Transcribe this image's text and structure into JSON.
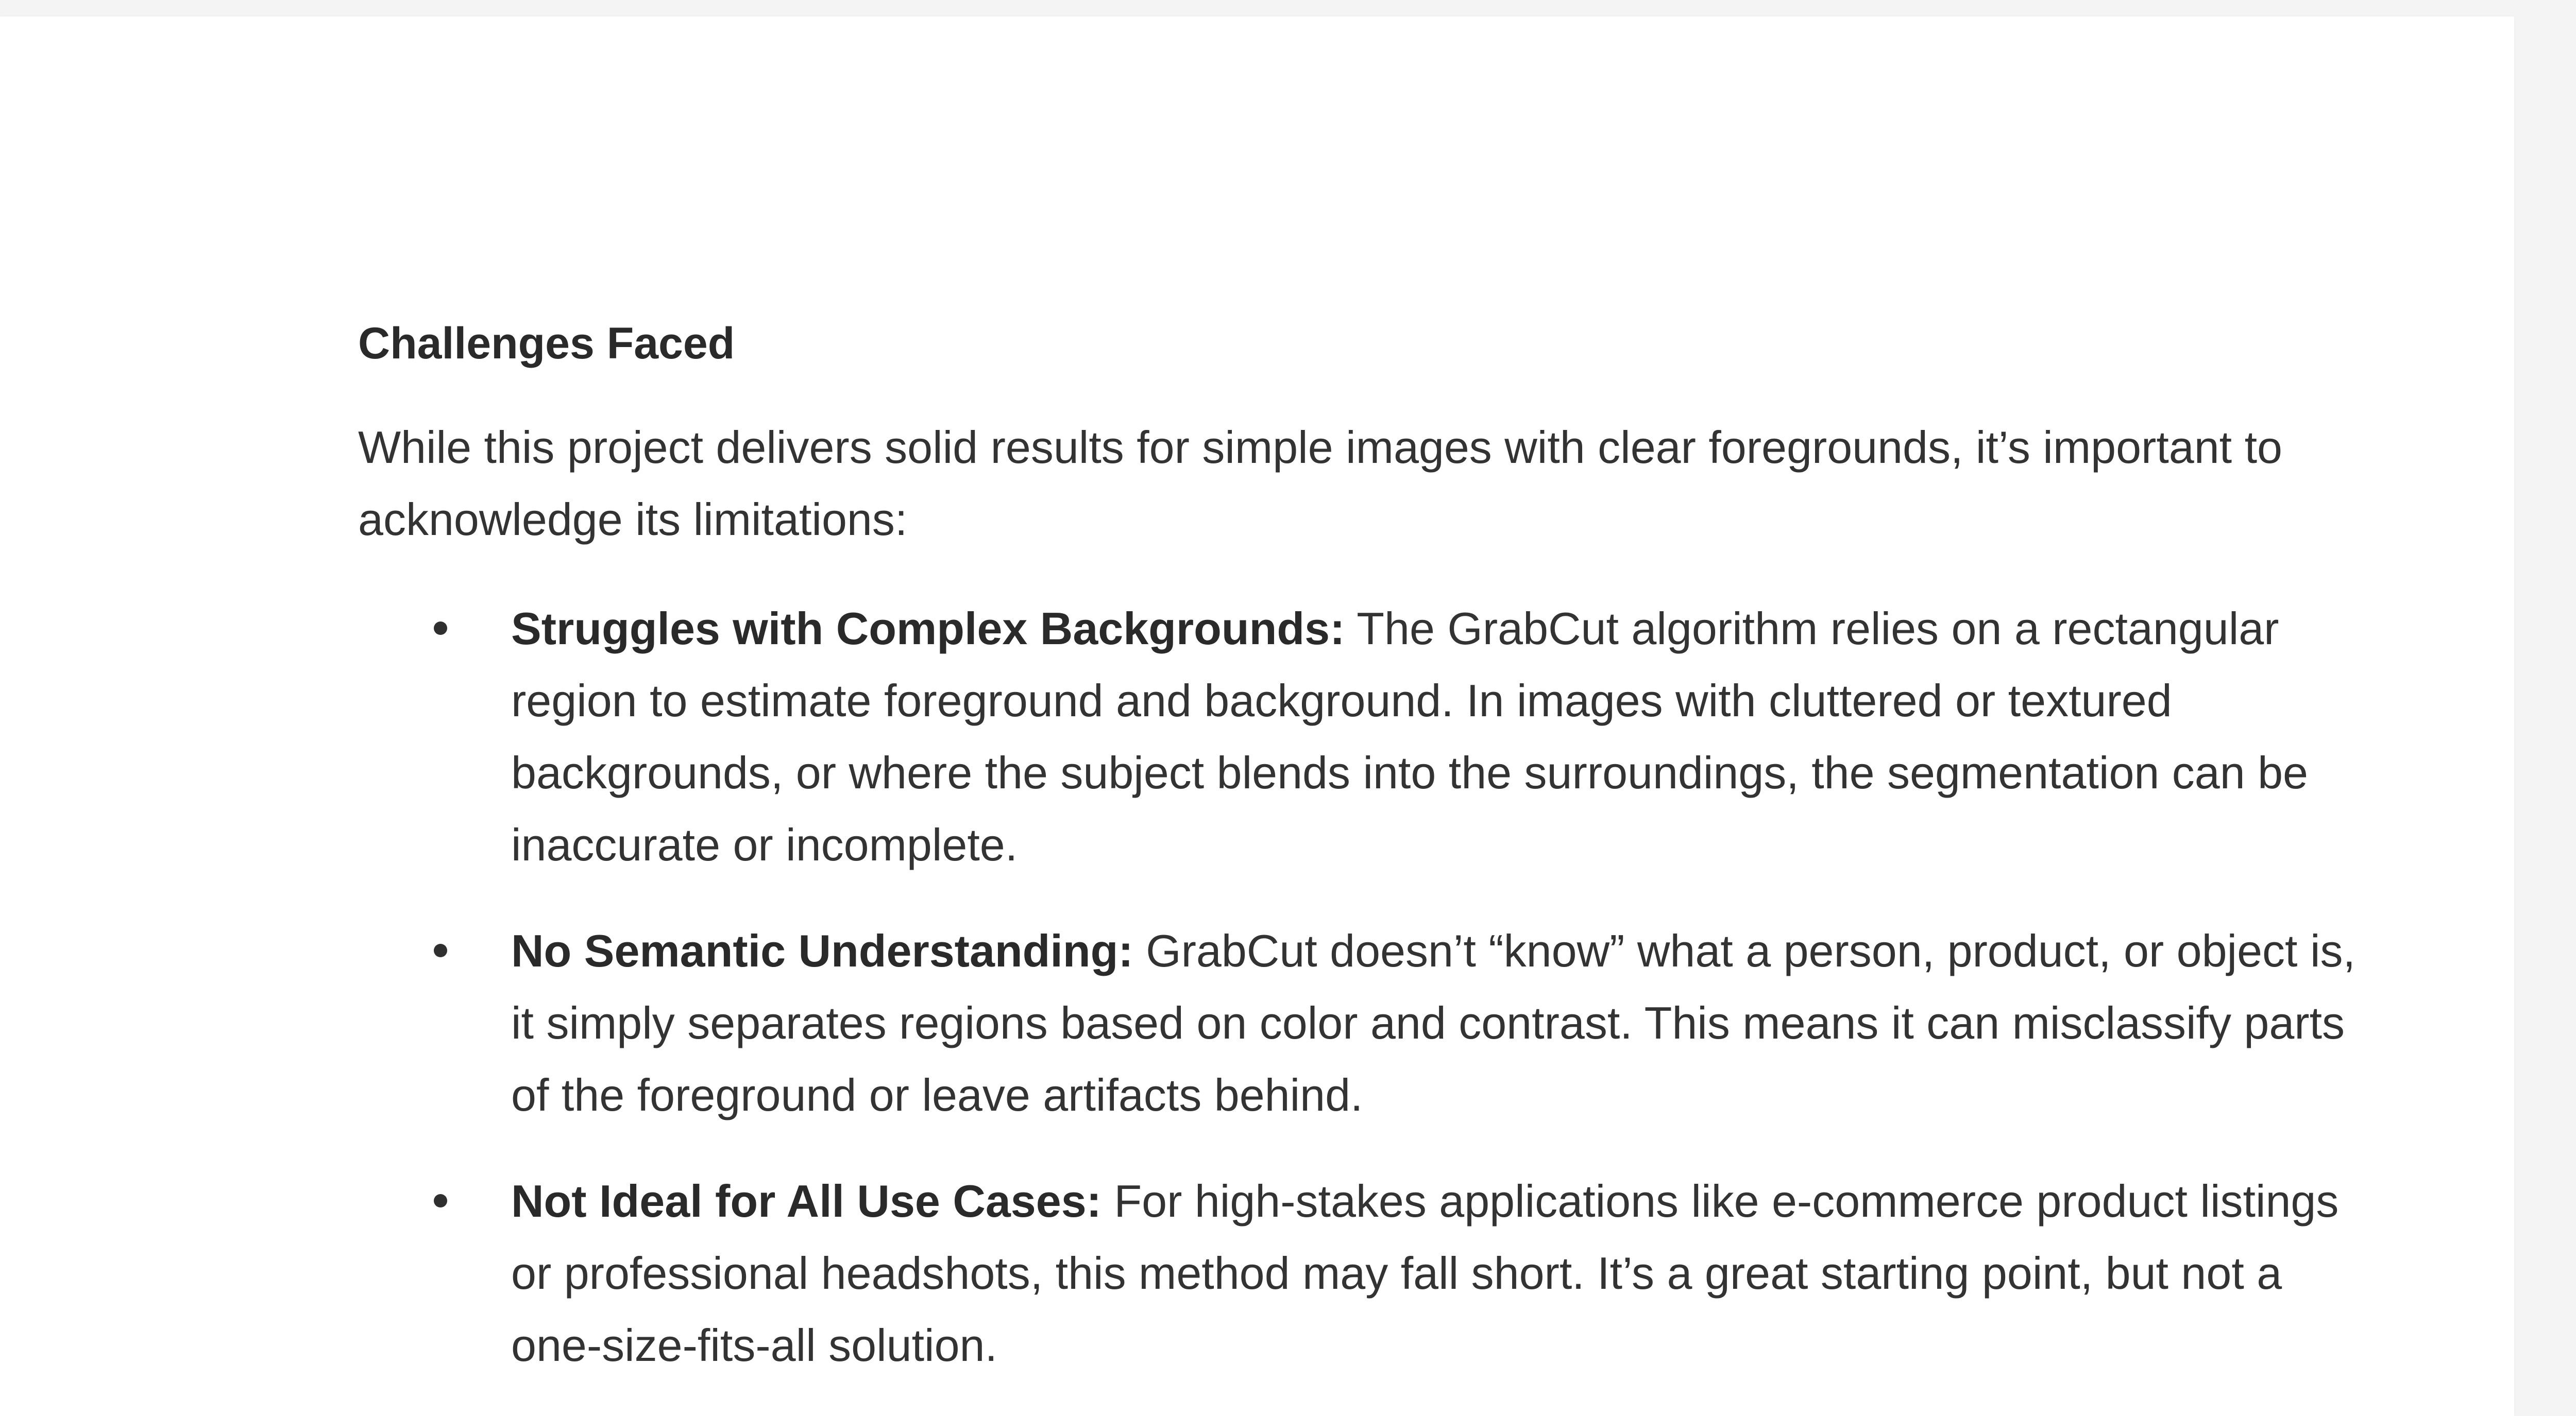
{
  "document": {
    "heading": "Challenges Faced",
    "intro": "While this project delivers solid results for simple images with clear foregrounds, it’s important to acknowledge its limitations:",
    "bullets": [
      {
        "title": "Struggles with Complex Backgrounds:",
        "text": " The GrabCut algorithm relies on a rectangular region to estimate foreground and background. In images with cluttered or textured backgrounds, or where the subject blends into the surroundings, the segmentation can be inaccurate or incomplete."
      },
      {
        "title": "No Semantic Understanding:",
        "text": " GrabCut doesn’t “know” what a person, product, or object is, it simply separates regions based on color and contrast. This means it can misclassify parts of the foreground or leave artifacts behind."
      },
      {
        "title": "Not Ideal for All Use Cases:",
        "text": " For high-stakes applications like e-commerce product listings or professional headshots, this method may fall short. It’s a great starting point, but not a one-size-fits-all solution."
      }
    ]
  }
}
